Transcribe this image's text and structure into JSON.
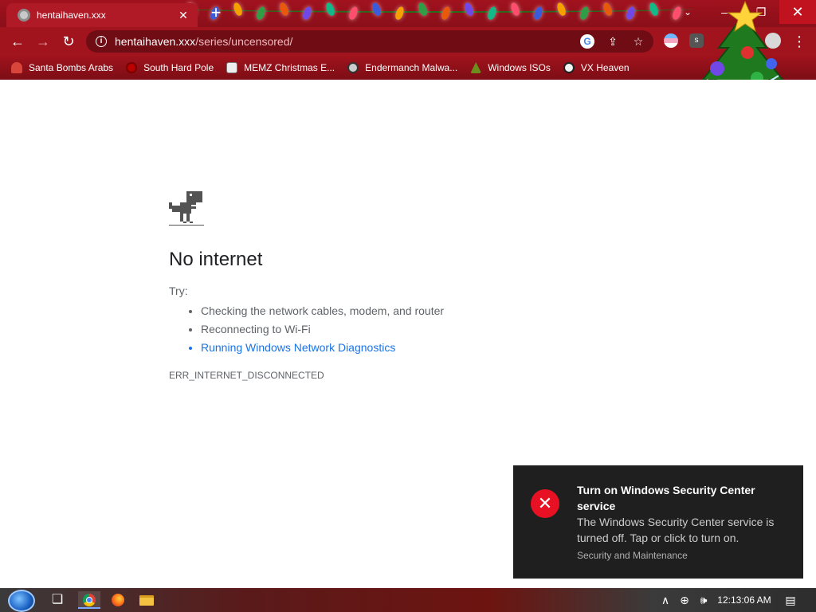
{
  "browser": {
    "tab": {
      "title": "hentaihaven.xxx",
      "close_glyph": "✕",
      "favicon": "globe-icon"
    },
    "new_tab_glyph": "+",
    "tab_search_glyph": "⌄",
    "window_controls": {
      "minimize_glyph": "–",
      "maximize_glyph": "❐",
      "close_glyph": "✕"
    },
    "toolbar": {
      "back_glyph": "←",
      "forward_glyph": "→",
      "reload_glyph": "↻",
      "info_glyph": "i",
      "url_host": "hentaihaven.xxx",
      "url_path": "/series/uncensored/",
      "google_glyph": "G",
      "share_glyph": "⇪",
      "star_glyph": "☆",
      "menu_glyph": "⋮",
      "extension_s_label": "s"
    },
    "bookmarks": [
      {
        "label": "Santa Bombs Arabs",
        "icon": "santa-icon"
      },
      {
        "label": "South Hard Pole",
        "icon": "virus-icon"
      },
      {
        "label": "MEMZ Christmas E...",
        "icon": "memz-icon"
      },
      {
        "label": "Endermanch Malwa...",
        "icon": "enderman-icon"
      },
      {
        "label": "Windows ISOs",
        "icon": "windows-tree-icon"
      },
      {
        "label": "VX Heaven",
        "icon": "vx-icon"
      }
    ],
    "accent_color": "#a1131d"
  },
  "error_page": {
    "headline": "No internet",
    "try_label": "Try:",
    "suggestions": [
      {
        "text": "Checking the network cables, modem, and router",
        "is_link": false
      },
      {
        "text": "Reconnecting to Wi-Fi",
        "is_link": false
      },
      {
        "text": "Running Windows Network Diagnostics",
        "is_link": true
      }
    ],
    "error_code": "ERR_INTERNET_DISCONNECTED"
  },
  "toast": {
    "icon_glyph": "✕",
    "title": "Turn on Windows Security Center service",
    "body": "The Windows Security Center service is turned off. Tap or click to turn on.",
    "source": "Security and Maintenance",
    "icon_color": "#e81123"
  },
  "taskbar": {
    "clock": "12:13:06 AM",
    "taskview_glyph": "❏",
    "chevron_glyph": "∧",
    "network_glyph": "⊕",
    "volume_glyph": "🕪",
    "notification_glyph": "▤",
    "pinned": [
      "chrome-icon",
      "firefox-icon",
      "file-explorer-icon"
    ]
  }
}
